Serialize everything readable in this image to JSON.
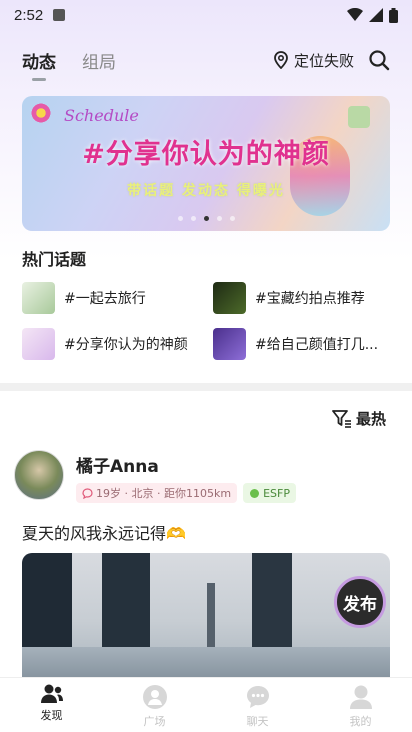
{
  "status_bar": {
    "time": "2:52"
  },
  "header": {
    "tabs": [
      {
        "label": "动态",
        "active": true
      },
      {
        "label": "组局",
        "active": false
      }
    ],
    "location_label": "定位失败"
  },
  "banner": {
    "brand": "Schedule",
    "headline": "#分享你认为的神颜",
    "subtitle": "带话题 发动态 得曝光",
    "dots": 5,
    "active_dot": 2
  },
  "hot_topics": {
    "title": "热门话题",
    "items": [
      {
        "label": "#一起去旅行",
        "thumb_color": "#cfe3c0"
      },
      {
        "label": "#宝藏约拍点推荐",
        "thumb_color": "#2d3b1e"
      },
      {
        "label": "#分享你认为的神颜",
        "thumb_color": "#e8d7f0"
      },
      {
        "label": "#给自己颜值打几...",
        "thumb_color": "#6a4fb0"
      }
    ]
  },
  "sort": {
    "label": "最热"
  },
  "post": {
    "username": "橘子Anna",
    "info_tag": "19岁 · 北京 · 距你1105km",
    "mbti": "ESFP",
    "text": "夏天的风我永远记得🫶"
  },
  "fab": {
    "label": "发布"
  },
  "bottom_nav": [
    {
      "label": "发现",
      "icon": "discover-icon",
      "active": true
    },
    {
      "label": "广场",
      "icon": "square-icon",
      "active": false
    },
    {
      "label": "聊天",
      "icon": "chat-icon",
      "active": false
    },
    {
      "label": "我的",
      "icon": "profile-icon",
      "active": false
    }
  ],
  "colors": {
    "accent_pink": "#e0328f",
    "fab_border": "#c59be0",
    "mbti_green": "#4a8a3a"
  }
}
